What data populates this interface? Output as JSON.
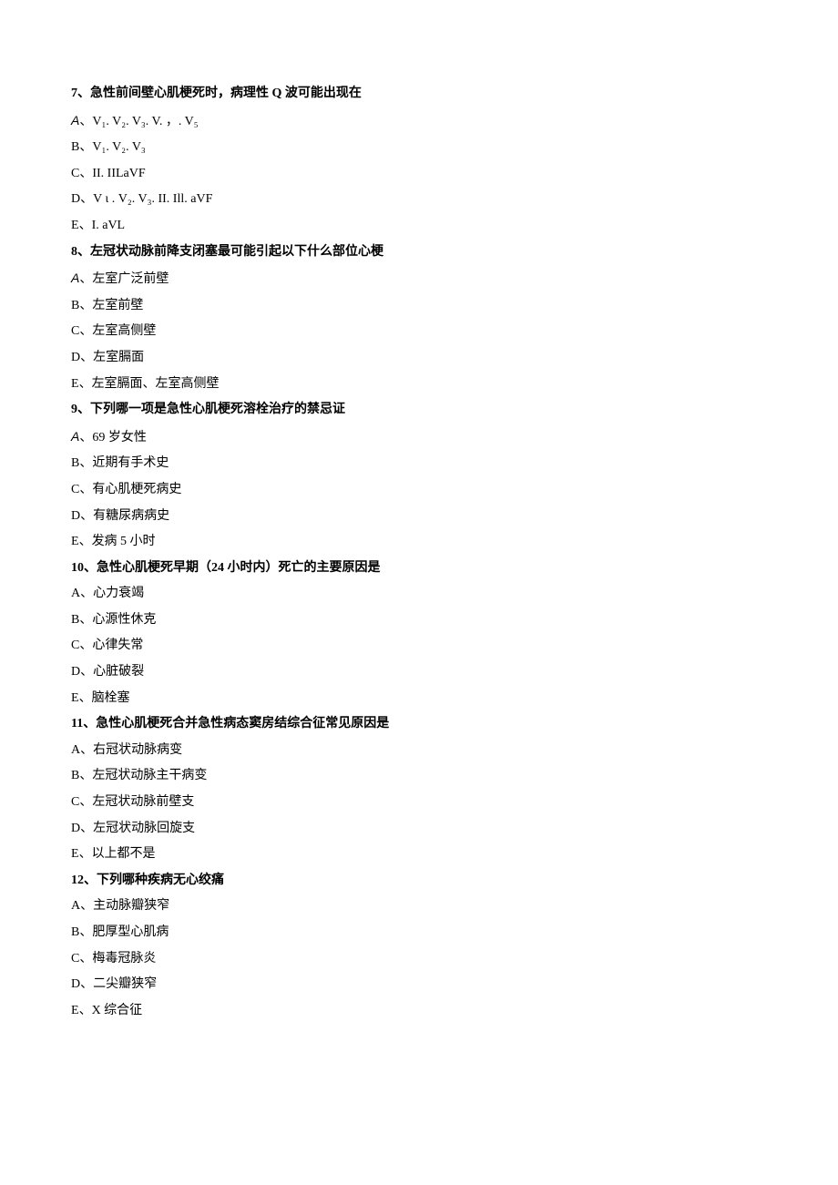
{
  "questions": [
    {
      "number": "7、",
      "stem": "急性前间壁心肌梗死时，病理性 Q 波可能出现在",
      "options": [
        {
          "label": "A",
          "labelClass": "opt-a",
          "sep": "、",
          "text": "V₁. V₂. V₃. V. ，. V₅"
        },
        {
          "label": "B",
          "sep": "、",
          "text": "V₁. V₂. V₃"
        },
        {
          "label": "C",
          "sep": "、",
          "text": "II. IILaVF"
        },
        {
          "label": "D",
          "sep": "、",
          "text": "V ι . V₂. V₃. II. Ill. aVF"
        },
        {
          "label": "E",
          "sep": "、",
          "text": "I. aVL"
        }
      ]
    },
    {
      "number": "8、",
      "stem": "左冠状动脉前降支闭塞最可能引起以下什么部位心梗",
      "options": [
        {
          "label": "A",
          "labelClass": "opt-a",
          "sep": "、",
          "text": "左室广泛前壁"
        },
        {
          "label": "B",
          "sep": "、",
          "text": "左室前壁"
        },
        {
          "label": "C",
          "sep": "、",
          "text": "左室高侧壁"
        },
        {
          "label": "D",
          "sep": "、",
          "text": "左室膈面"
        },
        {
          "label": "E",
          "sep": "、",
          "text": "左室膈面、左室高侧壁"
        }
      ]
    },
    {
      "number": "9、",
      "stem": "下列哪一项是急性心肌梗死溶栓治疗的禁忌证",
      "options": [
        {
          "label": "A",
          "labelClass": "opt-a",
          "sep": "、",
          "text": "69 岁女性"
        },
        {
          "label": "B",
          "sep": "、",
          "text": "近期有手术史"
        },
        {
          "label": "C",
          "sep": "、",
          "text": "有心肌梗死病史"
        },
        {
          "label": "D",
          "sep": "、",
          "text": "有糖尿病病史"
        },
        {
          "label": "E",
          "sep": "、",
          "text": "发病 5 小时"
        }
      ]
    },
    {
      "number": "10、",
      "stem": "急性心肌梗死早期（24 小时内）死亡的主要原因是",
      "options": [
        {
          "label": "A",
          "sep": "、",
          "text": "心力衰竭"
        },
        {
          "label": "B",
          "sep": "、",
          "text": "心源性休克"
        },
        {
          "label": "C",
          "sep": "、",
          "text": "心律失常"
        },
        {
          "label": "D",
          "sep": "、",
          "text": "心脏破裂"
        },
        {
          "label": "E",
          "sep": "、",
          "text": "脑栓塞"
        }
      ]
    },
    {
      "number": "11、",
      "stem": "急性心肌梗死合并急性病态窦房结综合征常见原因是",
      "options": [
        {
          "label": "A",
          "sep": "、",
          "text": "右冠状动脉病变"
        },
        {
          "label": "B",
          "sep": "、",
          "text": "左冠状动脉主干病变"
        },
        {
          "label": "C",
          "sep": "、",
          "text": "左冠状动脉前壁支"
        },
        {
          "label": "D",
          "sep": "、",
          "text": "左冠状动脉回旋支"
        },
        {
          "label": "E",
          "sep": "、",
          "text": "以上都不是"
        }
      ]
    },
    {
      "number": "12、",
      "stem": "下列哪种疾病无心绞痛",
      "options": [
        {
          "label": "A",
          "sep": "、",
          "text": "主动脉瓣狭窄"
        },
        {
          "label": "B",
          "sep": "、",
          "text": "肥厚型心肌病"
        },
        {
          "label": "C",
          "sep": "、",
          "text": "梅毒冠脉炎"
        },
        {
          "label": "D",
          "sep": "、",
          "text": "二尖瓣狭窄"
        },
        {
          "label": "E",
          "sep": "、",
          "text": "X 综合征"
        }
      ]
    }
  ]
}
